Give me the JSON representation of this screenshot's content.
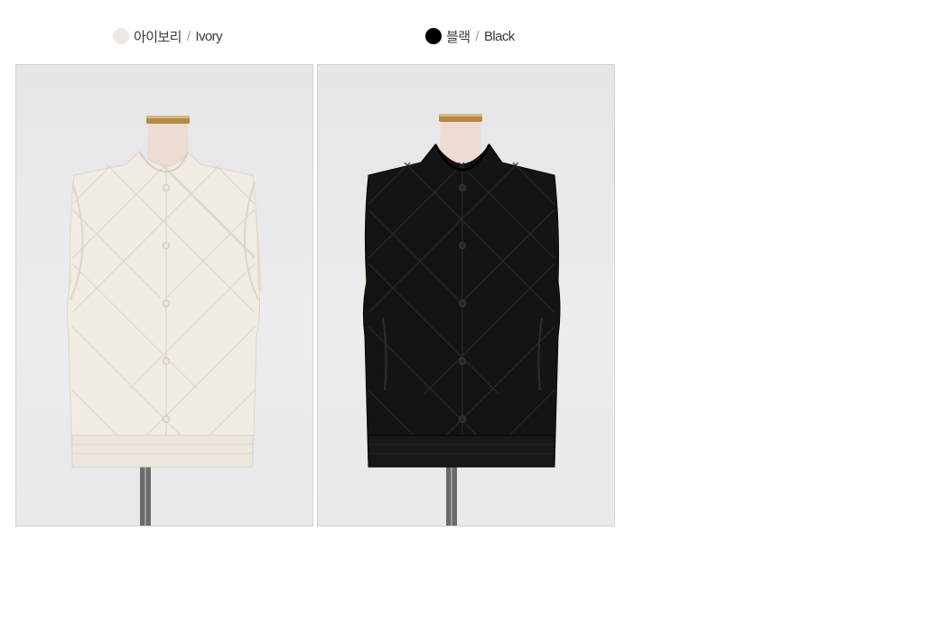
{
  "variants": [
    {
      "korean": "아이보리",
      "separator": "/",
      "english": "Ivory",
      "swatch_color": "#ede8e1",
      "image_alt": "Ivory quilted vest on mannequin"
    },
    {
      "korean": "블랙",
      "separator": "/",
      "english": "Black",
      "swatch_color": "#000000",
      "image_alt": "Black quilted vest on mannequin"
    }
  ],
  "colors": {
    "ivory_fabric": "#f0ebe3",
    "black_fabric": "#141414",
    "background": "#ececee"
  }
}
